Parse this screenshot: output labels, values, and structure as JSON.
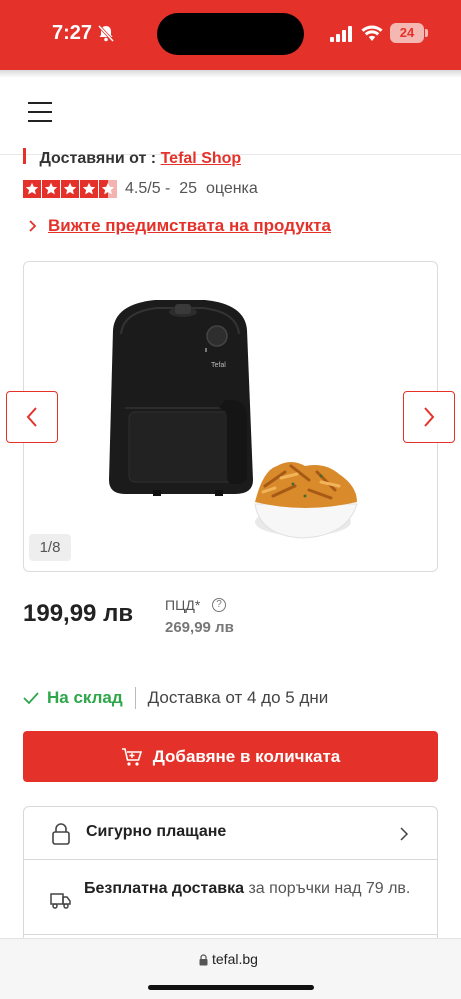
{
  "status_bar": {
    "time": "7:27",
    "battery": "24"
  },
  "seller": {
    "label": "Доставяни от :",
    "name": "Tefal Shop"
  },
  "rating": {
    "value": 4.5,
    "max": 5,
    "text": "4.5/5 -  25  оценка"
  },
  "benefits_link": "Вижте предимствата на продукта",
  "gallery": {
    "counter": "1/8",
    "brand_on_device": "Tefal"
  },
  "price": {
    "current": "199,99 лв",
    "rrp_label": "ПЦД*",
    "rrp_help": "?",
    "rrp_value": "269,99 лв"
  },
  "stock": {
    "status": "На склад",
    "delivery": "Доставка от 4 до 5 дни"
  },
  "add_to_cart": "Добавяне в количката",
  "features": [
    {
      "title": "Сигурно плащане"
    },
    {
      "title": "Безплатна доставка",
      "detail": "за поръчки над 79 лв."
    }
  ],
  "browser": {
    "url": "tefal.bg"
  },
  "colors": {
    "brand": "#e4322b",
    "in_stock": "#2ea64a"
  },
  "icons": [
    "bell-off-icon",
    "signal-icon",
    "wifi-icon",
    "battery-icon",
    "hamburger-menu-icon",
    "star-icon",
    "chevron-right-icon",
    "chevron-left-icon",
    "help-icon",
    "check-icon",
    "cart-icon",
    "lock-icon",
    "truck-icon"
  ]
}
